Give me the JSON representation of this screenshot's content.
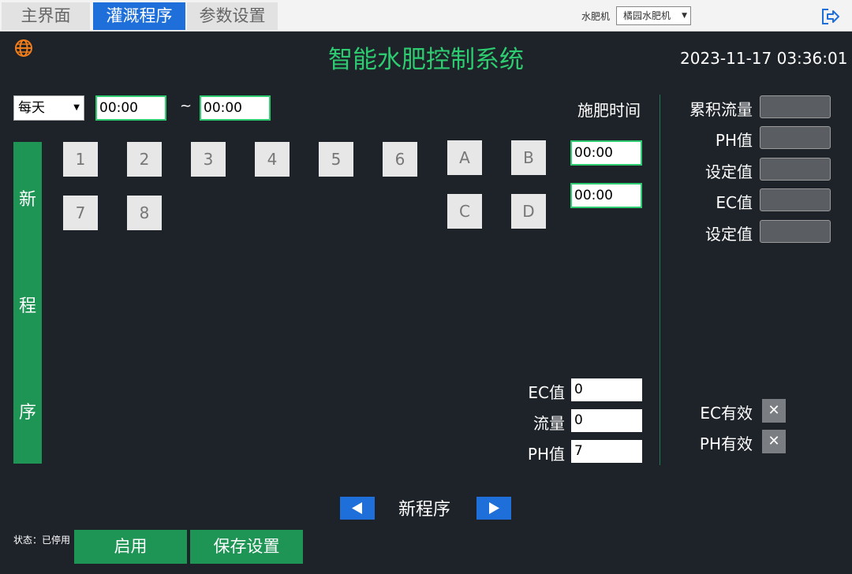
{
  "tabs": [
    {
      "label": "主界面",
      "active": false
    },
    {
      "label": "灌溉程序",
      "active": true
    },
    {
      "label": "参数设置",
      "active": false
    }
  ],
  "machine": {
    "label": "水肥机",
    "selected": "橘园水肥机"
  },
  "header": {
    "title": "智能水肥控制系统",
    "datetime": "2023-11-17 03:36:01"
  },
  "schedule": {
    "frequency": "每天",
    "start_time": "00:00",
    "separator": "~",
    "end_time": "00:00"
  },
  "program_label": [
    "新",
    "程",
    "序"
  ],
  "program_buttons": {
    "row1": [
      "1",
      "2",
      "3",
      "4",
      "5",
      "6",
      "A",
      "B"
    ],
    "row2": [
      "7",
      "8"
    ],
    "row2_right": [
      "C",
      "D"
    ]
  },
  "fertilize": {
    "label": "施肥时间",
    "time1": "00:00",
    "time2": "00:00"
  },
  "readings": {
    "cumulative_flow": "累积流量",
    "ph": "PH值",
    "setpoint1": "设定值",
    "ec": "EC值",
    "setpoint2": "设定值"
  },
  "params": {
    "ec_label": "EC值",
    "ec_value": "0",
    "flow_label": "流量",
    "flow_value": "0",
    "ph_label": "PH值",
    "ph_value": "7"
  },
  "toggles": {
    "ec_valid": "EC有效",
    "ph_valid": "PH有效",
    "mark": "✕"
  },
  "nav": {
    "title": "新程序"
  },
  "status": "状态：已停用",
  "buttons": {
    "enable": "启用",
    "save": "保存设置"
  },
  "colors": {
    "accent_green": "#2ecc71",
    "button_green": "#1e9455",
    "tab_blue": "#1e6fd9",
    "background": "#1e2229"
  },
  "icons": [
    "globe-icon",
    "exit-icon",
    "chevron-down-icon",
    "arrow-left-icon",
    "arrow-right-icon",
    "close-icon"
  ]
}
